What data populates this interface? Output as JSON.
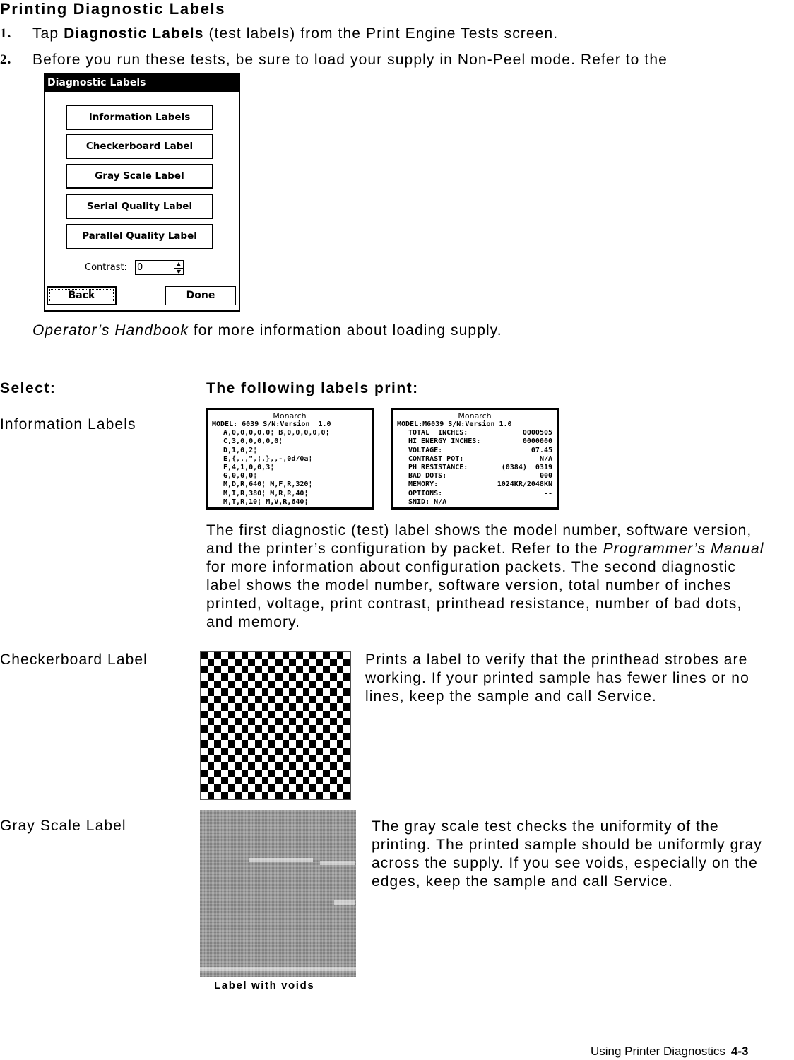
{
  "heading": "Printing Diagnostic Labels",
  "steps": [
    {
      "num": "1.",
      "pre": "Tap ",
      "bold": "Diagnostic Labels",
      "post": " (test labels) from the Print Engine Tests screen."
    },
    {
      "num": "2.",
      "text": "Before you run these tests, be sure to load your supply in Non-Peel mode.  Refer to the"
    }
  ],
  "step2_cont": {
    "italic": "Operator’s Handbook",
    "text": " for more information about loading supply."
  },
  "dialog": {
    "title": "Diagnostic Labels",
    "buttons": [
      "Information Labels",
      "Checkerboard Label",
      "Gray Scale Label",
      "Serial Quality Label",
      "Parallel Quality Label"
    ],
    "contrast_label": "Contrast:",
    "contrast_value": "0",
    "spin_up": "▲",
    "spin_down": "▼",
    "back": "Back",
    "done": "Done"
  },
  "table": {
    "col_select": "Select:",
    "col_print": "The following labels print:"
  },
  "info": {
    "label": "Information Labels",
    "label1": {
      "brand": "Monarch",
      "model": "MODEL: 6039 S/N:Version  1.0",
      "lines": [
        "A,0,0,0,0,0¦ B,0,0,0,0,0¦",
        "C,3,0,0,0,0,0¦",
        "D,1,0,2¦",
        "E,{,,,\",¦,},,-,0d/0a¦",
        "F,4,1,0,0,3¦",
        "G,0,0,0¦",
        "M,D,R,640¦ M,F,R,320¦",
        "M,I,R,380¦ M,R,R,40¦",
        "M,T,R,10¦ M,V,R,640¦"
      ]
    },
    "label2": {
      "brand": "Monarch",
      "model": "MODEL:M6039 S/N:Version 1.0",
      "rows": [
        {
          "k": "TOTAL  INCHES:",
          "v": "0000505"
        },
        {
          "k": "HI ENERGY INCHES:",
          "v": "0000000"
        },
        {
          "k": "VOLTAGE:",
          "v": "07.45"
        },
        {
          "k": "CONTRAST POT:",
          "v": "N/A"
        },
        {
          "k": "PH RESISTANCE:",
          "v": "(0384)  0319"
        },
        {
          "k": "BAD DOTS:",
          "v": "000"
        },
        {
          "k": "MEMORY:",
          "v": "1024KR/2048KN"
        },
        {
          "k": "OPTIONS:",
          "v": "--"
        },
        {
          "k": "SNID: N/A",
          "v": ""
        }
      ]
    },
    "desc_pre": "The first diagnostic (test) label shows the model number, software version, and the printer’s configuration by packet.  Refer to the ",
    "desc_italic": "Programmer’s Manual",
    "desc_post": " for more information about configuration packets.  The second diagnostic label shows the model number, software version, total number of inches printed, voltage, print contrast, printhead resistance, number of bad dots, and memory."
  },
  "checkerboard": {
    "label": "Checkerboard Label",
    "desc": "Prints a label to verify that the printhead strobes are working. If your printed sample has fewer lines or no lines, keep the sample and call Service.",
    "columns": 22,
    "rows": 20
  },
  "grayscale": {
    "label": "Gray Scale Label",
    "desc": "The gray scale test checks the uniformity of the printing.  The printed sample should be uniformly gray across the supply.  If you see voids, especially on the edges, keep the sample and call Service.",
    "caption": "Label with voids"
  },
  "footer": {
    "section": "Using Printer Diagnostics",
    "page": "4-3"
  }
}
